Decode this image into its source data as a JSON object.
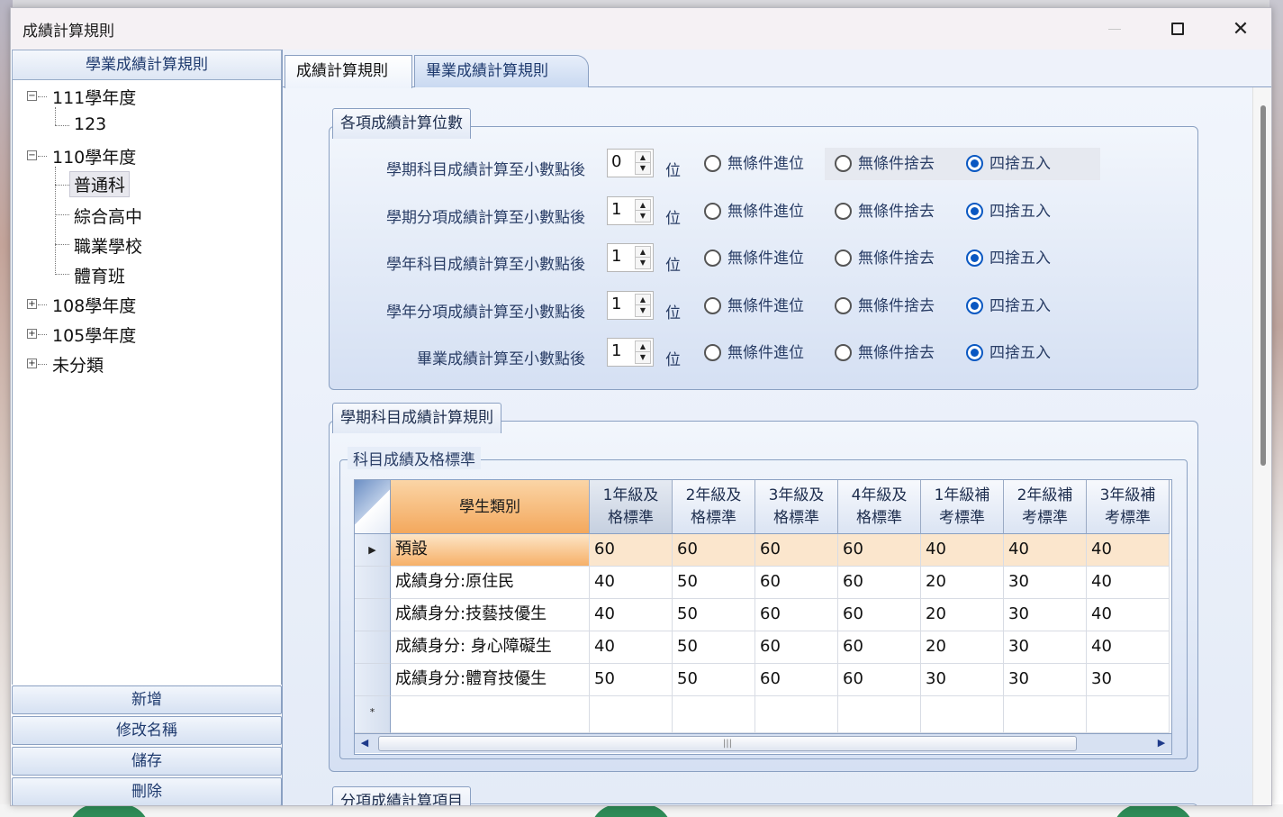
{
  "window": {
    "title": "成績計算規則"
  },
  "left_panel": {
    "header": "學業成績計算規則",
    "tree": [
      {
        "label": "111學年度",
        "expander": "−",
        "children": [
          "123"
        ]
      },
      {
        "label": "110學年度",
        "expander": "−",
        "children": [
          "普通科",
          "綜合高中",
          "職業學校",
          "體育班"
        ],
        "selected_child": "普通科"
      },
      {
        "label": "108學年度",
        "expander": "+"
      },
      {
        "label": "105學年度",
        "expander": "+"
      },
      {
        "label": "未分類",
        "expander": "+"
      }
    ],
    "buttons": {
      "add": "新增",
      "rename": "修改名稱",
      "save": "儲存",
      "delete": "刪除"
    }
  },
  "tabs": [
    {
      "label": "成績計算規則",
      "active": true
    },
    {
      "label": "畢業成績計算規則",
      "active": false
    }
  ],
  "decimal_group": {
    "title": "各項成績計算位數",
    "unit": "位",
    "radio_options": [
      "無條件進位",
      "無條件捨去",
      "四捨五入"
    ],
    "rows": [
      {
        "label": "學期科目成績計算至小數點後",
        "value": "0",
        "selected": "四捨五入"
      },
      {
        "label": "學期分項成績計算至小數點後",
        "value": "1",
        "selected": "四捨五入"
      },
      {
        "label": "學年科目成績計算至小數點後",
        "value": "1",
        "selected": "四捨五入"
      },
      {
        "label": "學年分項成績計算至小數點後",
        "value": "1",
        "selected": "四捨五入"
      },
      {
        "label": "畢業成績計算至小數點後",
        "value": "1",
        "selected": "四捨五入"
      }
    ]
  },
  "subject_group": {
    "title": "學期科目成績計算規則",
    "inner_legend": "科目成績及格標準",
    "grid": {
      "columns": [
        {
          "l1": "學生類別",
          "l2": ""
        },
        {
          "l1": "1年級及",
          "l2": "格標準"
        },
        {
          "l1": "2年級及",
          "l2": "格標準"
        },
        {
          "l1": "3年級及",
          "l2": "格標準"
        },
        {
          "l1": "4年級及",
          "l2": "格標準"
        },
        {
          "l1": "1年級補",
          "l2": "考標準"
        },
        {
          "l1": "2年級補",
          "l2": "考標準"
        },
        {
          "l1": "3年級補",
          "l2": "考標準"
        }
      ],
      "rows": [
        [
          "預設",
          "60",
          "60",
          "60",
          "60",
          "40",
          "40",
          "40"
        ],
        [
          "成績身分:原住民",
          "40",
          "50",
          "60",
          "60",
          "20",
          "30",
          "40"
        ],
        [
          "成績身分:技藝技優生",
          "40",
          "50",
          "60",
          "60",
          "20",
          "30",
          "40"
        ],
        [
          "成績身分: 身心障礙生",
          "40",
          "50",
          "60",
          "60",
          "20",
          "30",
          "40"
        ],
        [
          "成績身分:體育技優生",
          "50",
          "50",
          "60",
          "60",
          "30",
          "30",
          "30"
        ]
      ],
      "selected_row": 0,
      "new_row_marker": "*"
    }
  },
  "third_group": {
    "title": "分項成績計算項目"
  },
  "colors": {
    "accent_blue": "#0a58c2",
    "header_orange": "#f3a85d",
    "border_blue": "#8aa0c2"
  }
}
